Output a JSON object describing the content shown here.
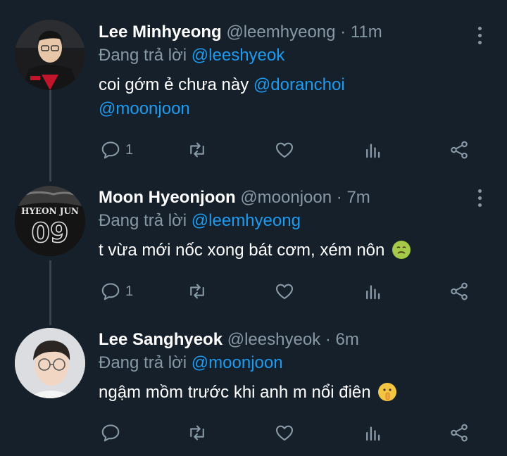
{
  "tweets": [
    {
      "name": "Lee Minhyeong",
      "handle": "@leemhyeong",
      "separator": "·",
      "time": "11m",
      "replying_prefix": "Đang trả lời",
      "replying_to": "@leeshyeok",
      "body_text": "coi gớm ẻ chưa này",
      "body_mentions": [
        "@doranchoi",
        "@moonjoon"
      ],
      "reply_count": "1",
      "avatar_icon": "player-photo-avatar"
    },
    {
      "name": "Moon Hyeonjoon",
      "handle": "@moonjoon",
      "separator": "·",
      "time": "7m",
      "replying_prefix": "Đang trả lời",
      "replying_to": "@leemhyeong",
      "body_text": "t vừa mới nốc xong bát cơm, xém nôn",
      "body_emoji": "nauseated-face",
      "reply_count": "1",
      "avatar_text_top": "HYEON JUN",
      "avatar_text_number": "09"
    },
    {
      "name": "Lee Sanghyeok",
      "handle": "@leeshyeok",
      "separator": "·",
      "time": "6m",
      "replying_prefix": "Đang trả lời",
      "replying_to": "@moonjoon",
      "body_text": "ngậm mồm trước khi anh m nổi điên",
      "body_emoji": "shushing-face",
      "reply_count": "",
      "avatar_icon": "player-photo-avatar"
    }
  ],
  "colors": {
    "background": "#15202b",
    "accent": "#1d9bf0",
    "secondary_text": "#8899a6"
  }
}
